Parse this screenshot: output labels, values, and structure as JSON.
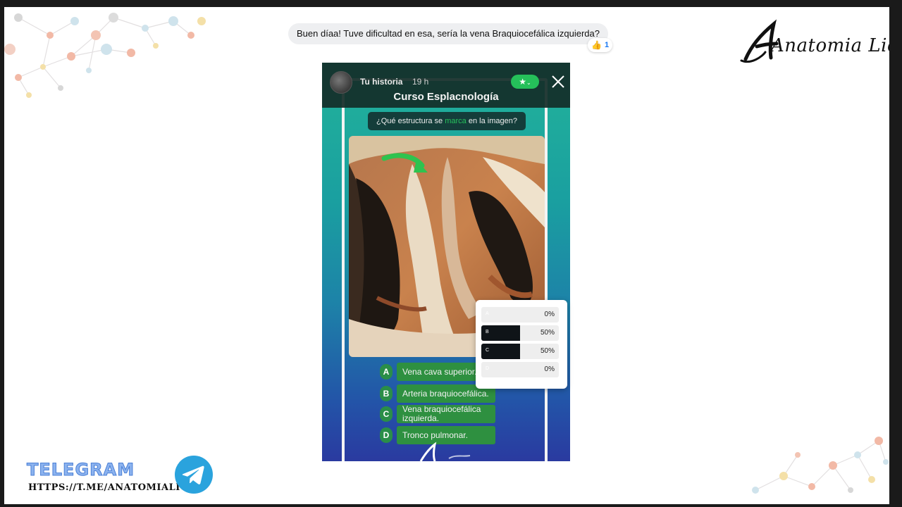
{
  "chat": {
    "message": "Buen díaa! Tuve dificultad en esa, sería la vena Braquiocefálica izquierda?",
    "reaction_emoji": "👍",
    "reaction_count": "1"
  },
  "brand": {
    "logo_text": "Anatomia Lio"
  },
  "story": {
    "username": "Tu historia",
    "time": "19 h",
    "title": "Curso Esplacnología",
    "question_before": "¿Qué estructura se ",
    "question_highlight": "marca",
    "question_after": " en la imagen?",
    "options": [
      {
        "letter": "A",
        "text": "Vena cava superior."
      },
      {
        "letter": "B",
        "text": "Arteria braquiocefálica."
      },
      {
        "letter": "C",
        "text": "Vena braquiocefálica izquierda."
      },
      {
        "letter": "D",
        "text": "Tronco pulmonar."
      }
    ],
    "accent_color": "#27c25c"
  },
  "results": [
    {
      "letter": "A",
      "percent_label": "0%",
      "fraction": 0
    },
    {
      "letter": "B",
      "percent_label": "50%",
      "fraction": 0.5
    },
    {
      "letter": "C",
      "percent_label": "50%",
      "fraction": 0.5
    },
    {
      "letter": "D",
      "percent_label": "0%",
      "fraction": 0
    }
  ],
  "telegram": {
    "label": "TELEGRAM",
    "url": "HTTPS://T.ME/ANATOMIALIO",
    "icon": "telegram-icon"
  }
}
